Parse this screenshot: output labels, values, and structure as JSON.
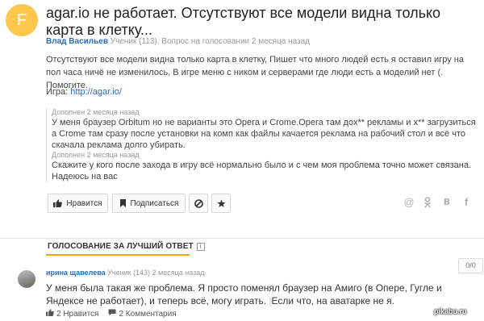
{
  "question": {
    "avatar_letter": "F",
    "title": "agar.io не работает. Отсутствуют все модели видна только карта в клетку...",
    "author": "Влад Васильев",
    "meta": "Ученик (113), Вопрос на голосовании 2 месяца назад",
    "body": "Отсутствуют все модели видна только карта в клетку, Пишет что много людей есть я оставил игру на пол часа ничё не изменилось, В игре меню с ником и серверами где люди есть а моделий нет (. Помогите.",
    "game_label": "Игра:",
    "game_link": "http://agar.io/",
    "additions": [
      {
        "label": "Дополнен 2 месяца назад",
        "text": "У меня браузер Orbitum но не варианты это Opera и Crome.Opera там дох** рекламы и х** загрузиться а Crome там сразу после установки на комп как файлы качается реклама на рабочий стол и всё что скачала реклама долго убирать."
      },
      {
        "label": "Дополнен 2 месяца назад",
        "text": "Скажите у кого после захода в игру всё нормально было и с чем моя проблема точно может связана. Надеюсь на вас"
      }
    ],
    "actions": {
      "like": "Нравится",
      "subscribe": "Подписаться"
    },
    "share_icons": [
      "at-icon",
      "odnoklassniki-icon",
      "vk-icon",
      "facebook-icon"
    ]
  },
  "voting": {
    "header": "ГОЛОСОВАНИЕ ЗА ЛУЧШИЙ ОТВЕТ",
    "accent": "#f7a600"
  },
  "answer": {
    "author": "ирина щавелева",
    "meta": "Ученик (143) 2 месяца назад",
    "score": "0/0",
    "body": "У меня была такая же проблема. Я просто поменял браузер на Амиго (в Опере, Гугле и Яндексе не работает), и теперь всё, могу играть.",
    "body_sep": "|",
    "body_extra": "Если что, на аватарке не я.",
    "likes": "2 Нравится",
    "comments": "2 Комментария"
  },
  "watermark": "pikabu.ru"
}
